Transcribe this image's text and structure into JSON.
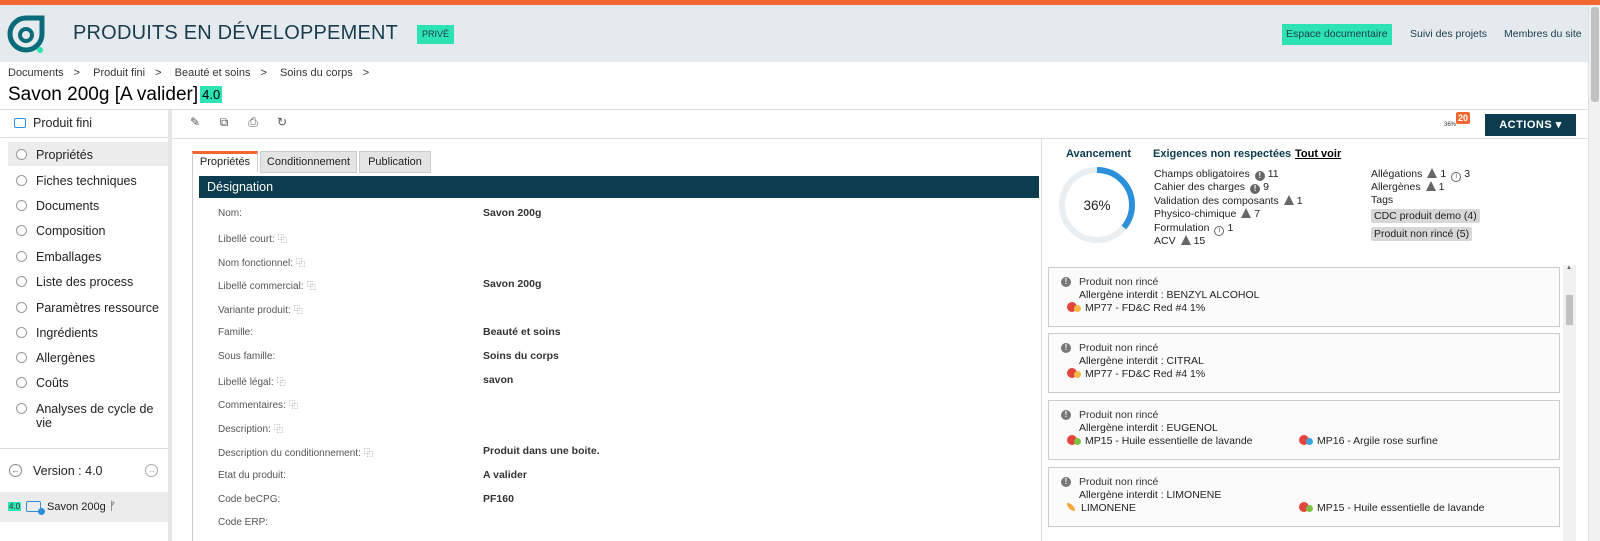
{
  "header": {
    "title": "PRODUITS EN DÉVELOPPEMENT",
    "private_badge": "PRIVÉ",
    "nav": [
      "Espace documentaire",
      "Suivi des projets",
      "Membres du site"
    ]
  },
  "breadcrumb": [
    "Documents",
    "Produit fini",
    "Beauté et soins",
    "Soins du corps"
  ],
  "page": {
    "title": "Savon 200g [A valider]",
    "version": "4.0"
  },
  "sidebar": {
    "head": "Produit fini",
    "items": [
      {
        "label": "Propriétés",
        "active": true
      },
      {
        "label": "Fiches techniques"
      },
      {
        "label": "Documents"
      },
      {
        "label": "Composition"
      },
      {
        "label": "Emballages"
      },
      {
        "label": "Liste des process"
      },
      {
        "label": "Paramètres ressource"
      },
      {
        "label": "Ingrédients"
      },
      {
        "label": "Allergènes"
      },
      {
        "label": "Coûts"
      },
      {
        "label": "Analyses de cycle de vie"
      }
    ],
    "version_label": "Version : 4.0",
    "current_version": "4.0",
    "current_name": "Savon 200g"
  },
  "toolbar": {
    "notif_percent": "36%",
    "notif_count": "20",
    "actions_label": "ACTIONS ▾"
  },
  "tabs": [
    "Propriétés",
    "Conditionnement",
    "Publication"
  ],
  "section": {
    "title": "Désignation"
  },
  "fields": [
    {
      "label": "Nom:",
      "value": "Savon 200g",
      "translatable": false
    },
    {
      "label": "Libellé court:",
      "value": "",
      "translatable": true
    },
    {
      "label": "Nom fonctionnel:",
      "value": "",
      "translatable": true
    },
    {
      "label": "Libellé commercial:",
      "value": "Savon 200g",
      "translatable": true
    },
    {
      "label": "Variante produit:",
      "value": "",
      "translatable": true
    },
    {
      "label": "Famille:",
      "value": "Beauté et soins",
      "translatable": false
    },
    {
      "label": "Sous famille:",
      "value": "Soins du corps",
      "translatable": false
    },
    {
      "label": "Libellé légal:",
      "value": "savon",
      "translatable": true
    },
    {
      "label": "Commentaires:",
      "value": "",
      "translatable": true
    },
    {
      "label": "Description:",
      "value": "",
      "translatable": true
    },
    {
      "label": "Description du conditionnement:",
      "value": "Produit dans une boite.",
      "translatable": true
    },
    {
      "label": "Etat du produit:",
      "value": "A valider",
      "translatable": false
    },
    {
      "label": "Code beCPG:",
      "value": "PF160",
      "translatable": false
    },
    {
      "label": "Code ERP:",
      "value": "",
      "translatable": false
    }
  ],
  "progress": {
    "title": "Avancement",
    "percent_label": "36%",
    "fraction": 0.36,
    "color": "#2b90d9"
  },
  "requirements": {
    "title": "Exigences non respectées",
    "see_all": "Tout voir",
    "left": [
      {
        "label": "Champs obligatoires",
        "icon": "exclamation-icon",
        "count": "11"
      },
      {
        "label": "Cahier des charges",
        "icon": "exclamation-icon",
        "count": "9"
      },
      {
        "label": "Validation des composants",
        "icon": "warning-icon",
        "count": "1"
      },
      {
        "label": "Physico-chimique",
        "icon": "warning-icon",
        "count": "7"
      },
      {
        "label": "Formulation",
        "icon": "info-icon",
        "count": "1"
      },
      {
        "label": "ACV",
        "icon": "warning-icon",
        "count": "15"
      }
    ],
    "allegations": {
      "label": "Allégations",
      "warn": "1",
      "info": "3"
    },
    "allergens": {
      "label": "Allergènes",
      "warn": "1"
    },
    "tags_label": "Tags",
    "tags": [
      "CDC produit demo (4)",
      "Produit non rincé (5)"
    ]
  },
  "cards": [
    {
      "title": "Produit non rincé",
      "sub": "Allergène interdit : BENZYL ALCOHOL",
      "items": [
        {
          "text": "MP77 - FD&C Red #4 1%",
          "dot": "#f4b942"
        }
      ]
    },
    {
      "title": "Produit non rincé",
      "sub": "Allergène interdit : CITRAL",
      "items": [
        {
          "text": "MP77 - FD&C Red #4 1%",
          "dot": "#f4b942"
        }
      ]
    },
    {
      "title": "Produit non rincé",
      "sub": "Allergène interdit : EUGENOL",
      "items": [
        {
          "text": "MP15 - Huile essentielle de lavande",
          "dot": "#7cc242"
        },
        {
          "text": "MP16 - Argile rose surfine",
          "dot": "#3aa6e0"
        }
      ]
    },
    {
      "title": "Produit non rincé",
      "sub": "Allergène interdit : LIMONENE",
      "items": [
        {
          "text": "LIMONENE",
          "dot": "leaf"
        },
        {
          "text": "MP15 - Huile essentielle de lavande",
          "dot": "#7cc242"
        }
      ]
    }
  ]
}
